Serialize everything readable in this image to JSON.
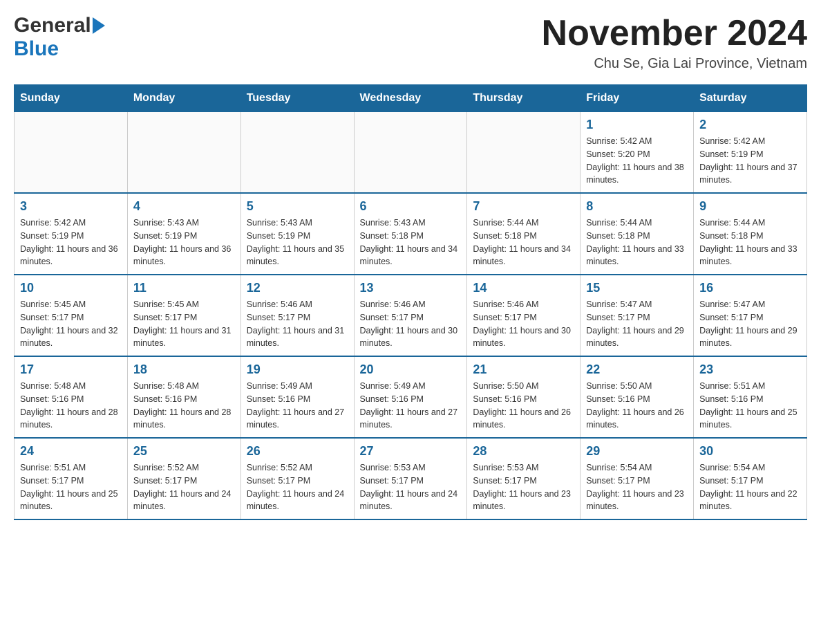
{
  "logo": {
    "general": "General",
    "blue": "Blue"
  },
  "title": "November 2024",
  "subtitle": "Chu Se, Gia Lai Province, Vietnam",
  "days_header": [
    "Sunday",
    "Monday",
    "Tuesday",
    "Wednesday",
    "Thursday",
    "Friday",
    "Saturday"
  ],
  "weeks": [
    [
      {
        "day": "",
        "info": ""
      },
      {
        "day": "",
        "info": ""
      },
      {
        "day": "",
        "info": ""
      },
      {
        "day": "",
        "info": ""
      },
      {
        "day": "",
        "info": ""
      },
      {
        "day": "1",
        "info": "Sunrise: 5:42 AM\nSunset: 5:20 PM\nDaylight: 11 hours and 38 minutes."
      },
      {
        "day": "2",
        "info": "Sunrise: 5:42 AM\nSunset: 5:19 PM\nDaylight: 11 hours and 37 minutes."
      }
    ],
    [
      {
        "day": "3",
        "info": "Sunrise: 5:42 AM\nSunset: 5:19 PM\nDaylight: 11 hours and 36 minutes."
      },
      {
        "day": "4",
        "info": "Sunrise: 5:43 AM\nSunset: 5:19 PM\nDaylight: 11 hours and 36 minutes."
      },
      {
        "day": "5",
        "info": "Sunrise: 5:43 AM\nSunset: 5:19 PM\nDaylight: 11 hours and 35 minutes."
      },
      {
        "day": "6",
        "info": "Sunrise: 5:43 AM\nSunset: 5:18 PM\nDaylight: 11 hours and 34 minutes."
      },
      {
        "day": "7",
        "info": "Sunrise: 5:44 AM\nSunset: 5:18 PM\nDaylight: 11 hours and 34 minutes."
      },
      {
        "day": "8",
        "info": "Sunrise: 5:44 AM\nSunset: 5:18 PM\nDaylight: 11 hours and 33 minutes."
      },
      {
        "day": "9",
        "info": "Sunrise: 5:44 AM\nSunset: 5:18 PM\nDaylight: 11 hours and 33 minutes."
      }
    ],
    [
      {
        "day": "10",
        "info": "Sunrise: 5:45 AM\nSunset: 5:17 PM\nDaylight: 11 hours and 32 minutes."
      },
      {
        "day": "11",
        "info": "Sunrise: 5:45 AM\nSunset: 5:17 PM\nDaylight: 11 hours and 31 minutes."
      },
      {
        "day": "12",
        "info": "Sunrise: 5:46 AM\nSunset: 5:17 PM\nDaylight: 11 hours and 31 minutes."
      },
      {
        "day": "13",
        "info": "Sunrise: 5:46 AM\nSunset: 5:17 PM\nDaylight: 11 hours and 30 minutes."
      },
      {
        "day": "14",
        "info": "Sunrise: 5:46 AM\nSunset: 5:17 PM\nDaylight: 11 hours and 30 minutes."
      },
      {
        "day": "15",
        "info": "Sunrise: 5:47 AM\nSunset: 5:17 PM\nDaylight: 11 hours and 29 minutes."
      },
      {
        "day": "16",
        "info": "Sunrise: 5:47 AM\nSunset: 5:17 PM\nDaylight: 11 hours and 29 minutes."
      }
    ],
    [
      {
        "day": "17",
        "info": "Sunrise: 5:48 AM\nSunset: 5:16 PM\nDaylight: 11 hours and 28 minutes."
      },
      {
        "day": "18",
        "info": "Sunrise: 5:48 AM\nSunset: 5:16 PM\nDaylight: 11 hours and 28 minutes."
      },
      {
        "day": "19",
        "info": "Sunrise: 5:49 AM\nSunset: 5:16 PM\nDaylight: 11 hours and 27 minutes."
      },
      {
        "day": "20",
        "info": "Sunrise: 5:49 AM\nSunset: 5:16 PM\nDaylight: 11 hours and 27 minutes."
      },
      {
        "day": "21",
        "info": "Sunrise: 5:50 AM\nSunset: 5:16 PM\nDaylight: 11 hours and 26 minutes."
      },
      {
        "day": "22",
        "info": "Sunrise: 5:50 AM\nSunset: 5:16 PM\nDaylight: 11 hours and 26 minutes."
      },
      {
        "day": "23",
        "info": "Sunrise: 5:51 AM\nSunset: 5:16 PM\nDaylight: 11 hours and 25 minutes."
      }
    ],
    [
      {
        "day": "24",
        "info": "Sunrise: 5:51 AM\nSunset: 5:17 PM\nDaylight: 11 hours and 25 minutes."
      },
      {
        "day": "25",
        "info": "Sunrise: 5:52 AM\nSunset: 5:17 PM\nDaylight: 11 hours and 24 minutes."
      },
      {
        "day": "26",
        "info": "Sunrise: 5:52 AM\nSunset: 5:17 PM\nDaylight: 11 hours and 24 minutes."
      },
      {
        "day": "27",
        "info": "Sunrise: 5:53 AM\nSunset: 5:17 PM\nDaylight: 11 hours and 24 minutes."
      },
      {
        "day": "28",
        "info": "Sunrise: 5:53 AM\nSunset: 5:17 PM\nDaylight: 11 hours and 23 minutes."
      },
      {
        "day": "29",
        "info": "Sunrise: 5:54 AM\nSunset: 5:17 PM\nDaylight: 11 hours and 23 minutes."
      },
      {
        "day": "30",
        "info": "Sunrise: 5:54 AM\nSunset: 5:17 PM\nDaylight: 11 hours and 22 minutes."
      }
    ]
  ]
}
